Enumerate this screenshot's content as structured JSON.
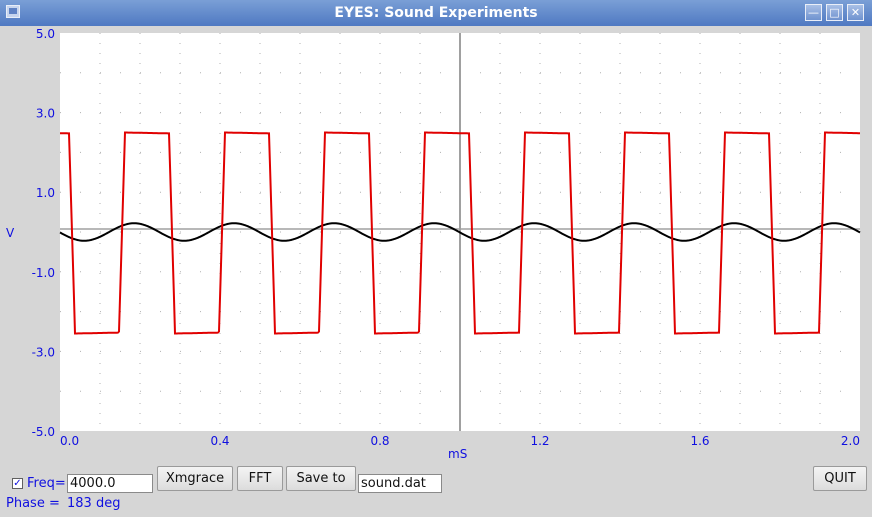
{
  "window": {
    "title": "EYES: Sound Experiments"
  },
  "plot": {
    "ylabel": "V",
    "xlabel": "mS",
    "y_tick_labels": [
      "5.0",
      "3.0",
      "1.0",
      "-1.0",
      "-3.0",
      "-5.0"
    ],
    "x_tick_labels": [
      "0.0",
      "0.4",
      "0.8",
      "1.2",
      "1.6",
      "2.0"
    ]
  },
  "chart_data": {
    "type": "line",
    "xlabel": "mS",
    "ylabel": "V",
    "xlim": [
      0,
      2.0
    ],
    "ylim": [
      -5,
      5
    ],
    "grid": true,
    "series": [
      {
        "color": "#e00000",
        "kind": "square",
        "frequency_khz": 4.0,
        "amplitude": 2.5,
        "phase_deg": 0
      },
      {
        "color": "#000000",
        "kind": "sine",
        "frequency_khz": 4.0,
        "amplitude": 0.22,
        "phase_deg": 183
      }
    ]
  },
  "controls": {
    "freq_label": "Freq=",
    "freq_value": "4000.0",
    "xmgrace_label": "Xmgrace",
    "fft_label": "FFT",
    "saveto_label": "Save to",
    "filename_value": "sound.dat",
    "quit_label": "QUIT",
    "phase_label": "Phase =",
    "phase_value": "183 deg"
  },
  "colors": {
    "square_wave": "#e00000",
    "sine_wave": "#000000",
    "axis_text": "#1010e0"
  }
}
